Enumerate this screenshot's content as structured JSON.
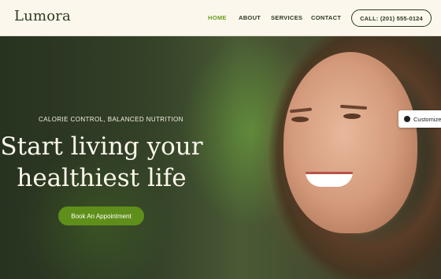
{
  "brand": {
    "name": "Lumora"
  },
  "nav": {
    "items": [
      {
        "label": "HOME",
        "active": true
      },
      {
        "label": "ABOUT",
        "active": false
      },
      {
        "label": "SERVICES",
        "active": false
      },
      {
        "label": "CONTACT",
        "active": false
      }
    ],
    "call_label": "CALL: (201) 555-0124"
  },
  "hero": {
    "subtitle": "CALORIE CONTROL, BALANCED NUTRITION",
    "headline_line1": "Start living your",
    "headline_line2": "healthiest life",
    "cta_label": "Book An Appointment"
  },
  "customize": {
    "label": "Customize",
    "icon": "palette-icon"
  },
  "colors": {
    "accent": "#5f8f1a",
    "active_nav": "#6b9e1f",
    "header_bg": "#fbf7ec",
    "text_dark": "#2d3a20"
  }
}
